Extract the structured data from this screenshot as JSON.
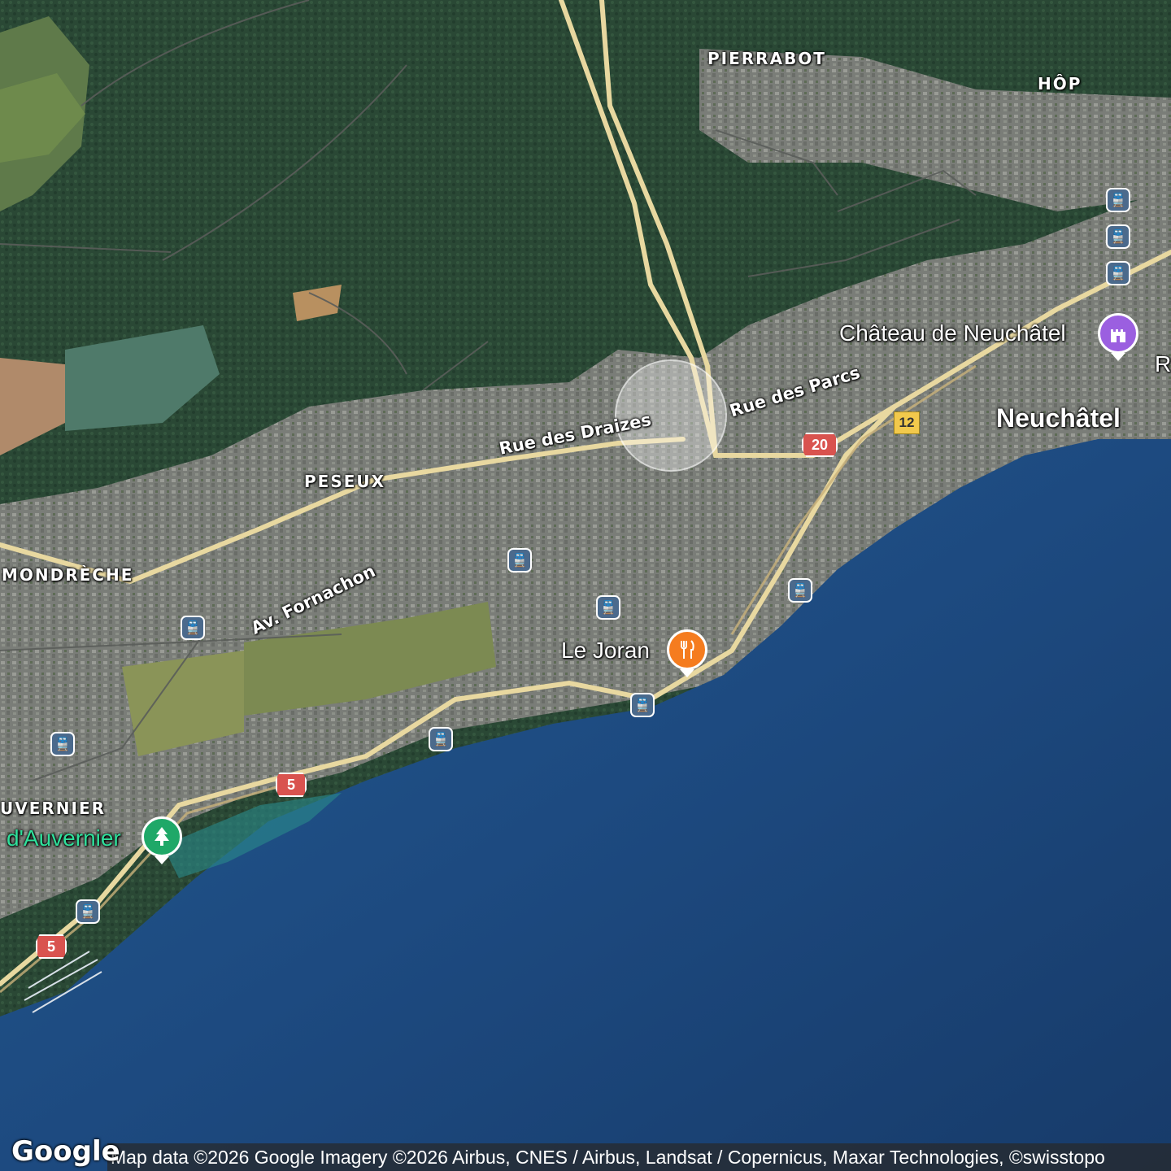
{
  "places": {
    "pierrabot": "PIERRABOT",
    "hop": "HÔP",
    "peseux": "PESEUX",
    "mondreche": "MONDRÈCHE",
    "auvernier": "UVERNIER",
    "neuchatel": "Neuchâtel",
    "r_edge": "R"
  },
  "pois": {
    "chateau": "Château de Neuchâtel",
    "le_joran": "Le Joran",
    "auvernier_park": "d'Auvernier"
  },
  "streets": {
    "draizes": "Rue des Draizes",
    "parcs": "Rue des Parcs",
    "fornachon": "Av. Fornachon"
  },
  "routes": {
    "r20": "20",
    "r12": "12",
    "r5a": "5",
    "r5b": "5"
  },
  "icons": {
    "chateau": "castle-icon",
    "le_joran": "restaurant-icon",
    "auvernier_park": "tree-icon",
    "transit": "train-icon"
  },
  "colors": {
    "lake": "#1d4a80",
    "forest": "#2b4a36",
    "urban": "#7c7f7a",
    "highway": "#e8d8a0",
    "castle_marker": "#9b5fe0",
    "restaurant_marker": "#f57c1f",
    "park_marker": "#1fa868",
    "transit_badge": "#4b6a8c",
    "route_red": "#d9534f",
    "route_yellow": "#f2c94c"
  },
  "footer": {
    "logo": "Google",
    "attribution": "Map data ©2026 Google Imagery ©2026 Airbus, CNES / Airbus, Landsat / Copernicus, Maxar Technologies, ©swisstopo"
  }
}
